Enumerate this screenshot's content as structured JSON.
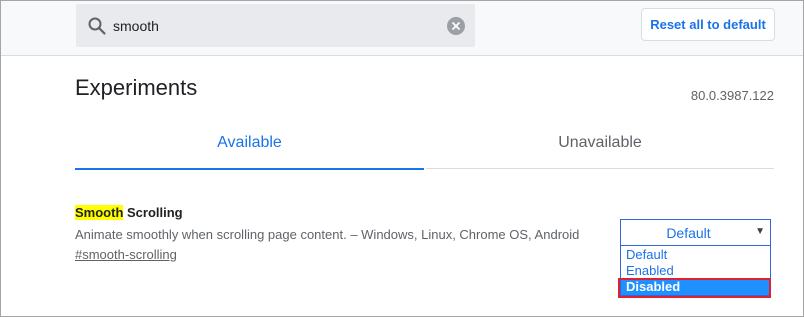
{
  "search": {
    "value": "smooth",
    "icon": "search-icon"
  },
  "header": {
    "reset_label": "Reset all to default"
  },
  "page": {
    "title": "Experiments",
    "version": "80.0.3987.122"
  },
  "tabs": [
    {
      "label": "Available",
      "active": true
    },
    {
      "label": "Unavailable",
      "active": false
    }
  ],
  "experiment": {
    "name_highlight": "Smooth",
    "name_rest": " Scrolling",
    "description": "Animate smoothly when scrolling page content. – Windows, Linux, Chrome OS, Android",
    "link": "#smooth-scrolling",
    "selected": "Default",
    "options": [
      "Default",
      "Enabled",
      "Disabled"
    ],
    "hovered_option": "Disabled"
  },
  "colors": {
    "accent": "#1a73e8",
    "highlight": "#ffff00",
    "option_hover": "#1e90ff",
    "annotation_box": "#e0202e"
  }
}
